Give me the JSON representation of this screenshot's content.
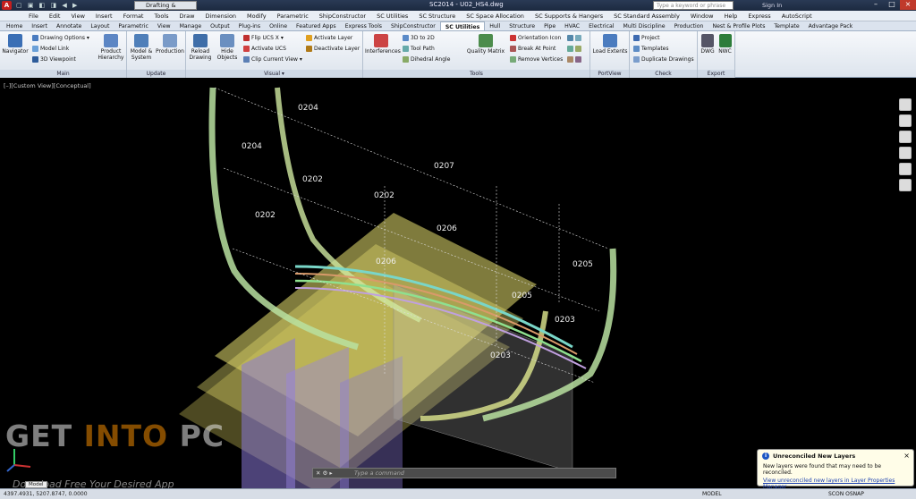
{
  "titlebar": {
    "workspace": "Drafting & Annotation",
    "document": "SC2014 - U02_HS4.dwg",
    "search_placeholder": "Type a keyword or phrase",
    "sign_in": "Sign In"
  },
  "menu": [
    "File",
    "Edit",
    "View",
    "Insert",
    "Format",
    "Tools",
    "Draw",
    "Dimension",
    "Modify",
    "Parametric",
    "ShipConstructor",
    "SC Utilities",
    "SC Structure",
    "SC Space Allocation",
    "SC Supports & Hangers",
    "SC Standard Assembly",
    "Window",
    "Help",
    "Express",
    "AutoScript"
  ],
  "tabs": [
    "Home",
    "Insert",
    "Annotate",
    "Layout",
    "Parametric",
    "View",
    "Manage",
    "Output",
    "Plug-ins",
    "Online",
    "Featured Apps",
    "Express Tools",
    "ShipConstructor",
    "SC Utilities",
    "Hull",
    "Structure",
    "Pipe",
    "HVAC",
    "Electrical",
    "Multi Discipline",
    "Production",
    "Nest & Profile Plots",
    "Template",
    "Advantage Pack"
  ],
  "active_tab": "SC Utilities",
  "ribbon": {
    "main": {
      "title": "Main",
      "navigator": "Navigator",
      "drawing_options": "Drawing Options",
      "model_link": "Model Link",
      "viewpoint": "3D Viewpoint",
      "product_hierarchy": "Product Hierarchy"
    },
    "update": {
      "title": "Update",
      "model_system": "Model & System",
      "production": "Production"
    },
    "visual": {
      "title": "Visual",
      "reload_drawing": "Reload Drawing",
      "hide_objects": "Hide Objects",
      "flip_ucs": "Flip UCS X",
      "activate_ucs": "Activate UCS",
      "clip_current_view": "Clip Current View",
      "activate_layer": "Activate Layer",
      "deactivate_layer": "Deactivate Layer"
    },
    "tools": {
      "title": "Tools",
      "interferences": "Interferences",
      "to_2d": "3D to 2D",
      "tool_path": "Tool Path",
      "dihedral_angle": "Dihedral Angle",
      "quality_matrix": "Quality Matrix",
      "orientation_icon": "Orientation Icon",
      "break_at_point": "Break At Point",
      "remove_vertices": "Remove Vertices"
    },
    "portview": {
      "title": "PortView",
      "load_extents": "Load Extents"
    },
    "check": {
      "title": "Check",
      "project": "Project",
      "templates": "Templates",
      "duplicate_drawings": "Duplicate Drawings"
    },
    "export": {
      "title": "Export",
      "dwg": "DWG",
      "nwc": "NWC"
    }
  },
  "viewport": {
    "label": "[–][Custom View][Conceptual]",
    "frame_labels": [
      "0204",
      "0204",
      "0207",
      "0202",
      "0202",
      "0202",
      "0206",
      "0206",
      "0205",
      "0205",
      "0203",
      "0203"
    ]
  },
  "watermark": {
    "prefix": "GET ",
    "highlight": "INTO",
    "suffix": " PC",
    "sub": "Download Free Your Desired App"
  },
  "command": {
    "placeholder": "Type a command"
  },
  "notification": {
    "title": "Unreconciled New Layers",
    "message": "New layers were found that may need to be reconciled.",
    "link": "View unreconciled new layers in Layer Properties Manager"
  },
  "statusbar": {
    "coords": "4397.4931, 5207.8747, 0.0000",
    "model": "MODEL",
    "workspace": "SCON OSNAP"
  },
  "layout_tabs": [
    "Model"
  ]
}
